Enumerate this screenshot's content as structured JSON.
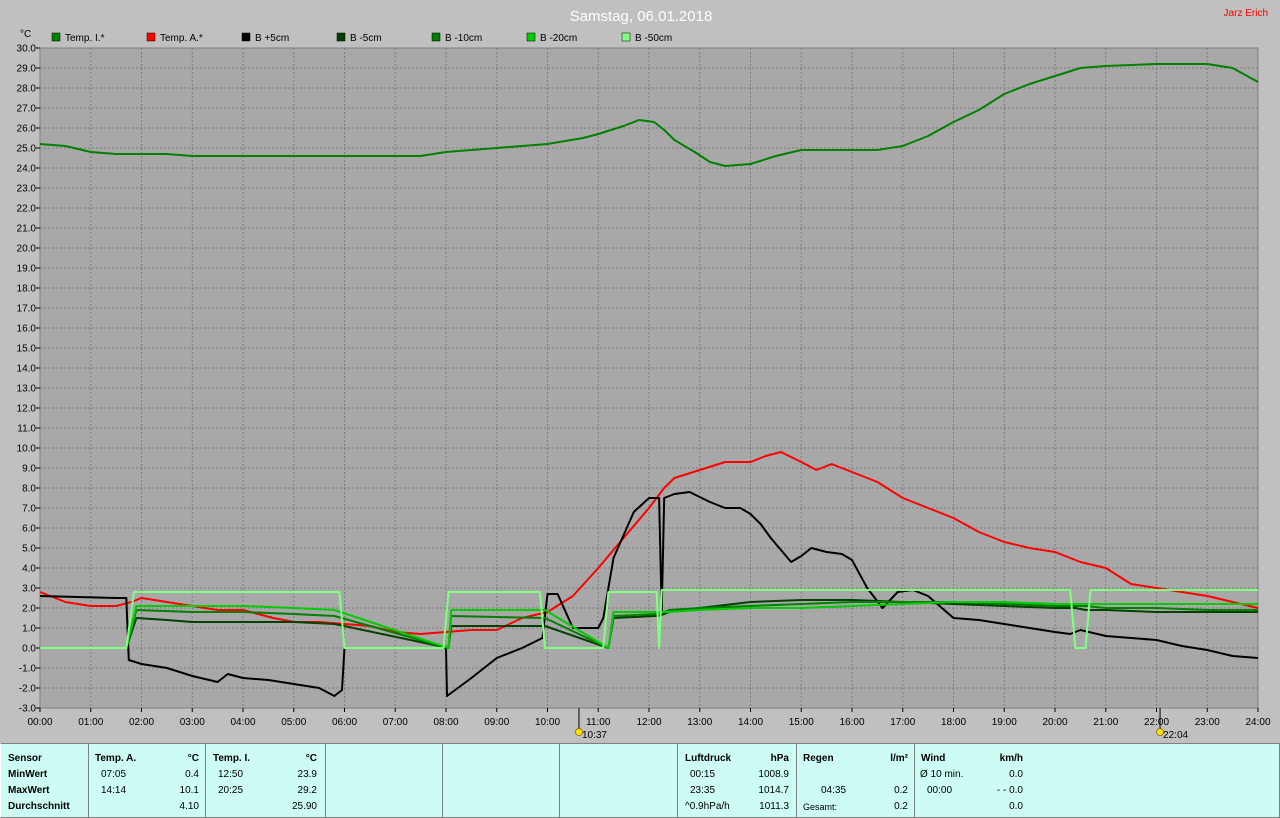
{
  "chart_data": {
    "type": "line",
    "title": "Samstag, 06.01.2018",
    "author": "Jarz Erich",
    "ylabel": "°C",
    "xlim": [
      0,
      24
    ],
    "ylim": [
      -3,
      30
    ],
    "y_ticks": [
      "-3.0",
      "-2.0",
      "-1.0",
      "0.0",
      "1.0",
      "2.0",
      "3.0",
      "4.0",
      "5.0",
      "6.0",
      "7.0",
      "8.0",
      "9.0",
      "10.0",
      "11.0",
      "12.0",
      "13.0",
      "14.0",
      "15.0",
      "16.0",
      "17.0",
      "18.0",
      "19.0",
      "20.0",
      "21.0",
      "22.0",
      "23.0",
      "24.0",
      "25.0",
      "26.0",
      "27.0",
      "28.0",
      "29.0",
      "30.0"
    ],
    "x_ticks": [
      "00:00",
      "01:00",
      "02:00",
      "03:00",
      "04:00",
      "05:00",
      "06:00",
      "07:00",
      "08:00",
      "09:00",
      "10:00",
      "11:00",
      "12:00",
      "13:00",
      "14:00",
      "15:00",
      "16:00",
      "17:00",
      "18:00",
      "19:00",
      "20:00",
      "21:00",
      "22:00",
      "23:00",
      "24:00"
    ],
    "grid": true,
    "legend_position": "top-left",
    "markers": [
      {
        "time": 10.62,
        "label": "10:37",
        "icon": "sunrise-icon"
      },
      {
        "time": 22.07,
        "label": "22:04",
        "icon": "sunset-icon"
      }
    ],
    "series": [
      {
        "name": "Temp. I.*",
        "color": "#008000",
        "points": [
          [
            0,
            25.2
          ],
          [
            0.5,
            25.1
          ],
          [
            1,
            24.8
          ],
          [
            1.5,
            24.7
          ],
          [
            2,
            24.7
          ],
          [
            2.5,
            24.7
          ],
          [
            3,
            24.6
          ],
          [
            4,
            24.6
          ],
          [
            5,
            24.6
          ],
          [
            6,
            24.6
          ],
          [
            7,
            24.6
          ],
          [
            7.5,
            24.6
          ],
          [
            8,
            24.8
          ],
          [
            9,
            25.0
          ],
          [
            10,
            25.2
          ],
          [
            10.7,
            25.5
          ],
          [
            11,
            25.7
          ],
          [
            11.5,
            26.1
          ],
          [
            11.8,
            26.4
          ],
          [
            12.1,
            26.3
          ],
          [
            12.3,
            25.9
          ],
          [
            12.5,
            25.4
          ],
          [
            12.9,
            24.8
          ],
          [
            13.2,
            24.3
          ],
          [
            13.5,
            24.1
          ],
          [
            14,
            24.2
          ],
          [
            14.5,
            24.6
          ],
          [
            15,
            24.9
          ],
          [
            16,
            24.9
          ],
          [
            16.5,
            24.9
          ],
          [
            17,
            25.1
          ],
          [
            17.5,
            25.6
          ],
          [
            18,
            26.3
          ],
          [
            18.5,
            26.9
          ],
          [
            19,
            27.7
          ],
          [
            19.5,
            28.2
          ],
          [
            20,
            28.6
          ],
          [
            20.5,
            29.0
          ],
          [
            21,
            29.1
          ],
          [
            22,
            29.2
          ],
          [
            23,
            29.2
          ],
          [
            23.5,
            29.0
          ],
          [
            24,
            28.3
          ]
        ]
      },
      {
        "name": "Temp. A.*",
        "color": "#ff0000",
        "points": [
          [
            0,
            2.8
          ],
          [
            0.5,
            2.3
          ],
          [
            1,
            2.1
          ],
          [
            1.5,
            2.1
          ],
          [
            1.8,
            2.3
          ],
          [
            2,
            2.5
          ],
          [
            2.5,
            2.3
          ],
          [
            3,
            2.1
          ],
          [
            3.5,
            1.9
          ],
          [
            4,
            1.9
          ],
          [
            4.3,
            1.7
          ],
          [
            4.6,
            1.5
          ],
          [
            5,
            1.3
          ],
          [
            5.5,
            1.3
          ],
          [
            6,
            1.2
          ],
          [
            6.5,
            1.1
          ],
          [
            7,
            0.8
          ],
          [
            7.5,
            0.7
          ],
          [
            8,
            0.8
          ],
          [
            8.5,
            0.9
          ],
          [
            9,
            0.9
          ],
          [
            9.5,
            1.5
          ],
          [
            10,
            1.8
          ],
          [
            10.5,
            2.6
          ],
          [
            11,
            4.0
          ],
          [
            11.5,
            5.5
          ],
          [
            12,
            7.0
          ],
          [
            12.3,
            8.0
          ],
          [
            12.5,
            8.5
          ],
          [
            13,
            8.9
          ],
          [
            13.5,
            9.3
          ],
          [
            14,
            9.3
          ],
          [
            14.3,
            9.6
          ],
          [
            14.6,
            9.8
          ],
          [
            15,
            9.3
          ],
          [
            15.3,
            8.9
          ],
          [
            15.6,
            9.2
          ],
          [
            16,
            8.8
          ],
          [
            16.5,
            8.3
          ],
          [
            17,
            7.5
          ],
          [
            17.5,
            7.0
          ],
          [
            18,
            6.5
          ],
          [
            18.5,
            5.8
          ],
          [
            19,
            5.3
          ],
          [
            19.5,
            5.0
          ],
          [
            20,
            4.8
          ],
          [
            20.5,
            4.3
          ],
          [
            21,
            4.0
          ],
          [
            21.5,
            3.2
          ],
          [
            22,
            3.0
          ],
          [
            22.5,
            2.8
          ],
          [
            23,
            2.6
          ],
          [
            23.5,
            2.3
          ],
          [
            24,
            2.0
          ]
        ]
      },
      {
        "name": "B +5cm",
        "color": "#000000",
        "points": [
          [
            0,
            2.6
          ],
          [
            1.5,
            2.5
          ],
          [
            1.7,
            2.5
          ],
          [
            1.75,
            -0.6
          ],
          [
            2,
            -0.8
          ],
          [
            2.5,
            -1.0
          ],
          [
            3,
            -1.4
          ],
          [
            3.5,
            -1.7
          ],
          [
            3.7,
            -1.3
          ],
          [
            4,
            -1.5
          ],
          [
            4.5,
            -1.6
          ],
          [
            5,
            -1.8
          ],
          [
            5.5,
            -2.0
          ],
          [
            5.8,
            -2.4
          ],
          [
            5.95,
            -2.1
          ],
          [
            6,
            0.0
          ],
          [
            7,
            0.0
          ],
          [
            8,
            0.0
          ],
          [
            8.02,
            -2.4
          ],
          [
            8.5,
            -1.5
          ],
          [
            9,
            -0.5
          ],
          [
            9.5,
            0.0
          ],
          [
            9.9,
            0.5
          ],
          [
            10,
            2.7
          ],
          [
            10.2,
            2.7
          ],
          [
            10.5,
            1.0
          ],
          [
            11,
            1.0
          ],
          [
            11.1,
            1.5
          ],
          [
            11.3,
            4.5
          ],
          [
            11.7,
            6.8
          ],
          [
            12,
            7.5
          ],
          [
            12.2,
            7.5
          ],
          [
            12.25,
            1.8
          ],
          [
            12.3,
            7.5
          ],
          [
            12.5,
            7.7
          ],
          [
            12.8,
            7.8
          ],
          [
            13.2,
            7.3
          ],
          [
            13.5,
            7.0
          ],
          [
            13.8,
            7.0
          ],
          [
            14,
            6.7
          ],
          [
            14.2,
            6.2
          ],
          [
            14.4,
            5.5
          ],
          [
            14.8,
            4.3
          ],
          [
            15,
            4.6
          ],
          [
            15.2,
            5.0
          ],
          [
            15.5,
            4.8
          ],
          [
            15.8,
            4.7
          ],
          [
            16,
            4.4
          ],
          [
            16.3,
            3.0
          ],
          [
            16.6,
            2.0
          ],
          [
            16.9,
            2.8
          ],
          [
            17.2,
            2.9
          ],
          [
            17.5,
            2.6
          ],
          [
            18,
            1.5
          ],
          [
            18.5,
            1.4
          ],
          [
            19,
            1.2
          ],
          [
            19.5,
            1.0
          ],
          [
            20,
            0.8
          ],
          [
            20.3,
            0.7
          ],
          [
            20.5,
            0.9
          ],
          [
            21,
            0.6
          ],
          [
            21.5,
            0.5
          ],
          [
            22,
            0.4
          ],
          [
            22.5,
            0.1
          ],
          [
            23,
            -0.1
          ],
          [
            23.5,
            -0.4
          ],
          [
            24,
            -0.5
          ]
        ]
      },
      {
        "name": "B -5cm",
        "color": "#004000",
        "points": [
          [
            1.7,
            0.0
          ],
          [
            1.9,
            1.5
          ],
          [
            2.5,
            1.4
          ],
          [
            3,
            1.3
          ],
          [
            4,
            1.3
          ],
          [
            5,
            1.3
          ],
          [
            5.8,
            1.2
          ],
          [
            8.05,
            0.0
          ],
          [
            8.1,
            1.1
          ],
          [
            9.5,
            1.1
          ],
          [
            9.95,
            1.1
          ],
          [
            11.2,
            0.0
          ],
          [
            11.3,
            1.5
          ],
          [
            12.1,
            1.6
          ],
          [
            12.2,
            1.6
          ],
          [
            12.4,
            1.8
          ],
          [
            13,
            2.0
          ],
          [
            14,
            2.3
          ],
          [
            15,
            2.4
          ],
          [
            16,
            2.4
          ],
          [
            17,
            2.3
          ],
          [
            18,
            2.2
          ],
          [
            19,
            2.1
          ],
          [
            20,
            2.0
          ],
          [
            20.4,
            2.0
          ],
          [
            20.6,
            1.9
          ],
          [
            21,
            1.9
          ],
          [
            22,
            1.8
          ],
          [
            23,
            1.8
          ],
          [
            24,
            1.8
          ]
        ]
      },
      {
        "name": "B -10cm",
        "color": "#008000",
        "points": [
          [
            1.7,
            0.0
          ],
          [
            1.9,
            1.9
          ],
          [
            3,
            1.8
          ],
          [
            4,
            1.8
          ],
          [
            5,
            1.7
          ],
          [
            5.8,
            1.6
          ],
          [
            8.05,
            0.0
          ],
          [
            8.1,
            1.6
          ],
          [
            9.95,
            1.5
          ],
          [
            11.2,
            0.0
          ],
          [
            11.3,
            1.6
          ],
          [
            12.2,
            1.7
          ],
          [
            12.4,
            1.9
          ],
          [
            13,
            2.0
          ],
          [
            14,
            2.1
          ],
          [
            15,
            2.2
          ],
          [
            16,
            2.3
          ],
          [
            17,
            2.3
          ],
          [
            18,
            2.3
          ],
          [
            19,
            2.2
          ],
          [
            20,
            2.1
          ],
          [
            20.4,
            2.1
          ],
          [
            20.6,
            2.1
          ],
          [
            21,
            2.0
          ],
          [
            22,
            2.0
          ],
          [
            23,
            1.9
          ],
          [
            24,
            1.9
          ]
        ]
      },
      {
        "name": "B -20cm",
        "color": "#00cc00",
        "points": [
          [
            1.7,
            0.0
          ],
          [
            1.9,
            2.1
          ],
          [
            3,
            2.1
          ],
          [
            4,
            2.1
          ],
          [
            5,
            2.0
          ],
          [
            5.8,
            1.9
          ],
          [
            8.05,
            0.0
          ],
          [
            8.1,
            1.9
          ],
          [
            9.95,
            1.9
          ],
          [
            11.2,
            0.0
          ],
          [
            11.3,
            1.8
          ],
          [
            12.2,
            1.8
          ],
          [
            12.4,
            1.8
          ],
          [
            13,
            1.9
          ],
          [
            14,
            2.0
          ],
          [
            15,
            2.0
          ],
          [
            16,
            2.1
          ],
          [
            17,
            2.2
          ],
          [
            18,
            2.3
          ],
          [
            19,
            2.3
          ],
          [
            20,
            2.2
          ],
          [
            20.4,
            2.2
          ],
          [
            20.6,
            2.2
          ],
          [
            21,
            2.2
          ],
          [
            22,
            2.2
          ],
          [
            23,
            2.2
          ],
          [
            24,
            2.2
          ]
        ]
      },
      {
        "name": "B -50cm",
        "color": "#80ff80",
        "points": [
          [
            0,
            0.0
          ],
          [
            1.7,
            0.0
          ],
          [
            1.85,
            2.8
          ],
          [
            5.9,
            2.8
          ],
          [
            6.0,
            0.0
          ],
          [
            7.95,
            0.0
          ],
          [
            8.05,
            2.8
          ],
          [
            9.85,
            2.8
          ],
          [
            9.95,
            0.0
          ],
          [
            11.1,
            0.0
          ],
          [
            11.2,
            2.8
          ],
          [
            12.15,
            2.8
          ],
          [
            12.2,
            0.0
          ],
          [
            12.25,
            2.9
          ],
          [
            20.3,
            2.9
          ],
          [
            20.4,
            0.0
          ],
          [
            20.6,
            0.0
          ],
          [
            20.7,
            2.9
          ],
          [
            24,
            2.9
          ]
        ]
      }
    ]
  },
  "summary": {
    "sensor": {
      "header": "Sensor",
      "rows": [
        "MinWert",
        "MaxWert",
        "Durchschnitt"
      ]
    },
    "temp_a": {
      "header": "Temp. A.",
      "unit": "°C",
      "min_time": "07:05",
      "min_val": "0.4",
      "max_time": "14:14",
      "max_val": "10.1",
      "avg": "4.10"
    },
    "temp_i": {
      "header": "Temp. I.",
      "unit": "°C",
      "min_time": "12:50",
      "min_val": "23.9",
      "max_time": "20:25",
      "max_val": "29.2",
      "avg": "25.90"
    },
    "pressure": {
      "header": "Luftdruck",
      "unit": "hPa",
      "min_time": "00:15",
      "min_val": "1008.9",
      "max_time": "23:35",
      "max_val": "1014.7",
      "trend_label": "^0.9hPa/h",
      "trend_val": "1011.3"
    },
    "rain": {
      "header": "Regen",
      "unit": "l/m²",
      "max_time": "04:35",
      "max_val": "0.2",
      "total_label": "Gesamt:",
      "total_val": "0.2"
    },
    "wind": {
      "header": "Wind",
      "unit": "km/h",
      "min_label": "Ø 10 min.",
      "min_val": "0.0",
      "max_time": "00:00",
      "max_val": "- - 0.0",
      "avg": "0.0"
    }
  }
}
